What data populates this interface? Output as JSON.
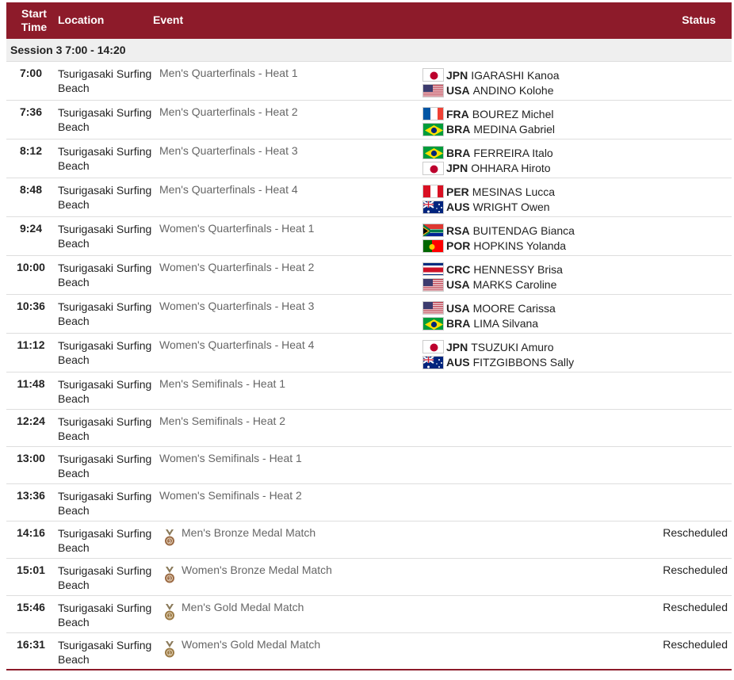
{
  "header": {
    "start_time": "Start Time",
    "location": "Location",
    "event": "Event",
    "status": "Status"
  },
  "session": "Session 3  7:00 - 14:20",
  "rows": [
    {
      "time": "7:00",
      "location": "Tsurigasaki Surfing Beach",
      "event": "Men's Quarterfinals - Heat 1",
      "athletes": [
        {
          "flag": "jpn",
          "code": "JPN",
          "name": "IGARASHI Kanoa"
        },
        {
          "flag": "usa",
          "code": "USA",
          "name": "ANDINO Kolohe"
        }
      ]
    },
    {
      "time": "7:36",
      "location": "Tsurigasaki Surfing Beach",
      "event": "Men's Quarterfinals - Heat 2",
      "athletes": [
        {
          "flag": "fra",
          "code": "FRA",
          "name": "BOUREZ Michel"
        },
        {
          "flag": "bra",
          "code": "BRA",
          "name": "MEDINA Gabriel"
        }
      ]
    },
    {
      "time": "8:12",
      "location": "Tsurigasaki Surfing Beach",
      "event": "Men's Quarterfinals - Heat 3",
      "athletes": [
        {
          "flag": "bra",
          "code": "BRA",
          "name": "FERREIRA Italo"
        },
        {
          "flag": "jpn",
          "code": "JPN",
          "name": "OHHARA Hiroto"
        }
      ]
    },
    {
      "time": "8:48",
      "location": "Tsurigasaki Surfing Beach",
      "event": "Men's Quarterfinals - Heat 4",
      "athletes": [
        {
          "flag": "per",
          "code": "PER",
          "name": "MESINAS Lucca"
        },
        {
          "flag": "aus",
          "code": "AUS",
          "name": "WRIGHT Owen"
        }
      ]
    },
    {
      "time": "9:24",
      "location": "Tsurigasaki Surfing Beach",
      "event": "Women's Quarterfinals - Heat 1",
      "athletes": [
        {
          "flag": "rsa",
          "code": "RSA",
          "name": "BUITENDAG Bianca"
        },
        {
          "flag": "por",
          "code": "POR",
          "name": "HOPKINS Yolanda"
        }
      ]
    },
    {
      "time": "10:00",
      "location": "Tsurigasaki Surfing Beach",
      "event": "Women's Quarterfinals - Heat 2",
      "athletes": [
        {
          "flag": "crc",
          "code": "CRC",
          "name": "HENNESSY Brisa"
        },
        {
          "flag": "usa",
          "code": "USA",
          "name": "MARKS Caroline"
        }
      ]
    },
    {
      "time": "10:36",
      "location": "Tsurigasaki Surfing Beach",
      "event": "Women's Quarterfinals - Heat 3",
      "athletes": [
        {
          "flag": "usa",
          "code": "USA",
          "name": "MOORE Carissa"
        },
        {
          "flag": "bra",
          "code": "BRA",
          "name": "LIMA Silvana"
        }
      ]
    },
    {
      "time": "11:12",
      "location": "Tsurigasaki Surfing Beach",
      "event": "Women's Quarterfinals - Heat 4",
      "athletes": [
        {
          "flag": "jpn",
          "code": "JPN",
          "name": "TSUZUKI Amuro"
        },
        {
          "flag": "aus",
          "code": "AUS",
          "name": "FITZGIBBONS Sally"
        }
      ]
    },
    {
      "time": "11:48",
      "location": "Tsurigasaki Surfing Beach",
      "event": "Men's Semifinals - Heat 1",
      "athletes": []
    },
    {
      "time": "12:24",
      "location": "Tsurigasaki Surfing Beach",
      "event": "Men's Semifinals - Heat 2",
      "athletes": []
    },
    {
      "time": "13:00",
      "location": "Tsurigasaki Surfing Beach",
      "event": "Women's Semifinals - Heat 1",
      "athletes": []
    },
    {
      "time": "13:36",
      "location": "Tsurigasaki Surfing Beach",
      "event": "Women's Semifinals - Heat 2",
      "athletes": []
    },
    {
      "time": "14:16",
      "location": "Tsurigasaki Surfing Beach",
      "event": "Men's Bronze Medal Match",
      "medal": "bronze",
      "status": "Rescheduled",
      "athletes": []
    },
    {
      "time": "15:01",
      "location": "Tsurigasaki Surfing Beach",
      "event": "Women's Bronze Medal Match",
      "medal": "bronze",
      "status": "Rescheduled",
      "athletes": []
    },
    {
      "time": "15:46",
      "location": "Tsurigasaki Surfing Beach",
      "event": "Men's Gold Medal Match",
      "medal": "gold",
      "status": "Rescheduled",
      "athletes": []
    },
    {
      "time": "16:31",
      "location": "Tsurigasaki Surfing Beach",
      "event": "Women's Gold Medal Match",
      "medal": "gold",
      "status": "Rescheduled",
      "athletes": []
    }
  ],
  "colors": {
    "header_bg": "#8d1b2a",
    "session_bg": "#efefef",
    "event_text": "#666666"
  }
}
